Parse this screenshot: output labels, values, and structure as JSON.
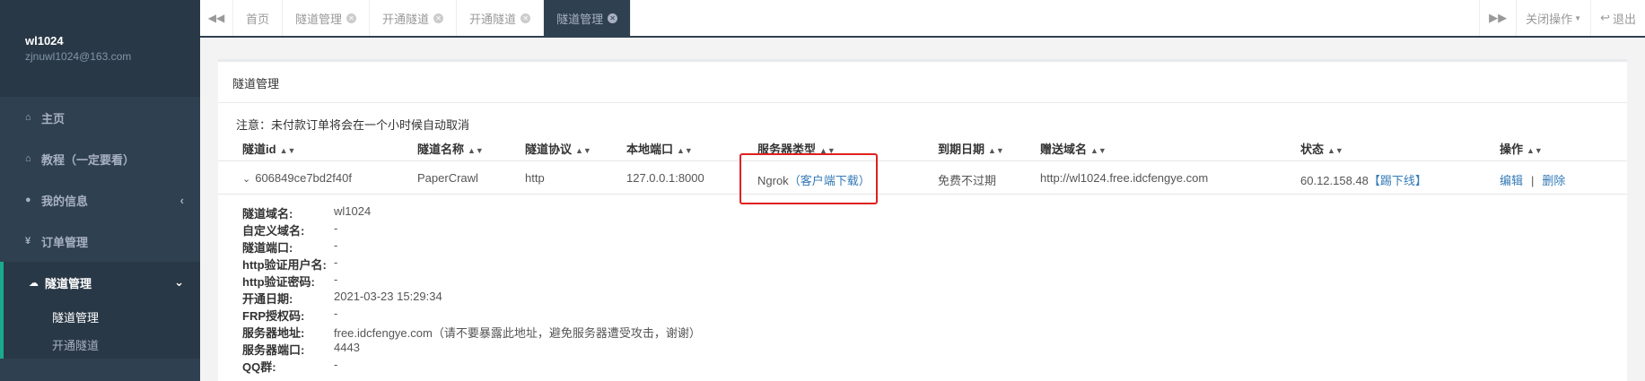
{
  "sidebar": {
    "username": "wl1024",
    "email": "zjnuwl1024@163.com",
    "items": [
      {
        "label": "主页",
        "icon": "home-icon"
      },
      {
        "label": "教程（一定要看）",
        "icon": "home-icon"
      },
      {
        "label": "我的信息",
        "icon": "user-icon"
      },
      {
        "label": "订单管理",
        "icon": "yen-icon"
      },
      {
        "label": "隧道管理",
        "icon": "cloud-icon"
      }
    ],
    "submenu": [
      "隧道管理",
      "开通隧道"
    ]
  },
  "tabs": {
    "items": [
      "首页",
      "隧道管理",
      "开通隧道",
      "开通隧道",
      "隧道管理"
    ],
    "close_ops": "关闭操作",
    "logout": "退出"
  },
  "panel": {
    "title": "隧道管理",
    "notice": "注意：未付款订单将会在一个小时候自动取消",
    "columns": [
      "隧道id",
      "隧道名称",
      "隧道协议",
      "本地端口",
      "服务器类型",
      "到期日期",
      "赠送域名",
      "状态",
      "操作"
    ],
    "row": {
      "id": "606849ce7bd2f40f",
      "name": "PaperCrawl",
      "protocol": "http",
      "local_port": "127.0.0.1:8000",
      "server_type": "Ngrok",
      "client_download": "（客户端下载）",
      "expiry": "免费不过期",
      "domain": "http://wl1024.free.idcfengye.com",
      "status_ip": "60.12.158.48",
      "kick_offline": "【踢下线】",
      "edit": "编辑",
      "sep": "|",
      "delete": "删除"
    },
    "details": [
      {
        "label": "隧道域名:",
        "value": "wl1024"
      },
      {
        "label": "自定义域名:",
        "value": "-"
      },
      {
        "label": "隧道端口:",
        "value": "-"
      },
      {
        "label": "http验证用户名:",
        "value": "-"
      },
      {
        "label": "http验证密码:",
        "value": "-"
      },
      {
        "label": "开通日期:",
        "value": "2021-03-23 15:29:34"
      },
      {
        "label": "FRP授权码:",
        "value": "-"
      },
      {
        "label": "服务器地址:",
        "value": "free.idcfengye.com（请不要暴露此地址，避免服务器遭受攻击，谢谢）"
      },
      {
        "label": "服务器端口:",
        "value": "4443"
      },
      {
        "label": "QQ群:",
        "value": "-"
      }
    ]
  }
}
